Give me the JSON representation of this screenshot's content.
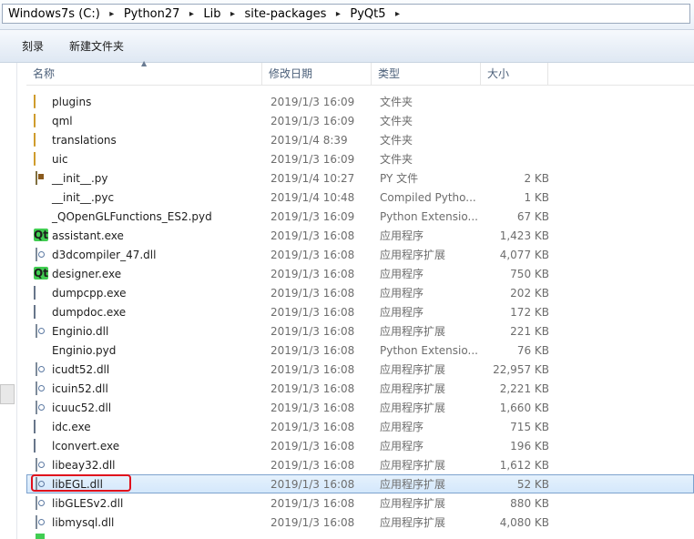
{
  "breadcrumb": [
    "Windows7s (C:)",
    "Python27",
    "Lib",
    "site-packages",
    "PyQt5"
  ],
  "toolbar": {
    "burn": "刻录",
    "new_folder": "新建文件夹"
  },
  "columns": {
    "name": "名称",
    "date": "修改日期",
    "type": "类型",
    "size": "大小"
  },
  "files": [
    {
      "name": "plugins",
      "date": "2019/1/3 16:09",
      "type": "文件夹",
      "size": "",
      "icon": "folder-icon"
    },
    {
      "name": "qml",
      "date": "2019/1/3 16:09",
      "type": "文件夹",
      "size": "",
      "icon": "folder-icon"
    },
    {
      "name": "translations",
      "date": "2019/1/4 8:39",
      "type": "文件夹",
      "size": "",
      "icon": "folder-icon"
    },
    {
      "name": "uic",
      "date": "2019/1/3 16:09",
      "type": "文件夹",
      "size": "",
      "icon": "folder-icon"
    },
    {
      "name": "__init__.py",
      "date": "2019/1/4 10:27",
      "type": "PY 文件",
      "size": "2 KB",
      "icon": "py-source-icon"
    },
    {
      "name": "__init__.pyc",
      "date": "2019/1/4 10:48",
      "type": "Compiled Pytho...",
      "size": "1 KB",
      "icon": "python-icon"
    },
    {
      "name": "_QOpenGLFunctions_ES2.pyd",
      "date": "2019/1/3 16:09",
      "type": "Python Extensio...",
      "size": "67 KB",
      "icon": "python-icon"
    },
    {
      "name": "assistant.exe",
      "date": "2019/1/3 16:08",
      "type": "应用程序",
      "size": "1,423 KB",
      "icon": "qt-icon"
    },
    {
      "name": "d3dcompiler_47.dll",
      "date": "2019/1/3 16:08",
      "type": "应用程序扩展",
      "size": "4,077 KB",
      "icon": "dll-icon"
    },
    {
      "name": "designer.exe",
      "date": "2019/1/3 16:08",
      "type": "应用程序",
      "size": "750 KB",
      "icon": "qt-icon"
    },
    {
      "name": "dumpcpp.exe",
      "date": "2019/1/3 16:08",
      "type": "应用程序",
      "size": "202 KB",
      "icon": "exe-icon"
    },
    {
      "name": "dumpdoc.exe",
      "date": "2019/1/3 16:08",
      "type": "应用程序",
      "size": "172 KB",
      "icon": "exe-icon"
    },
    {
      "name": "Enginio.dll",
      "date": "2019/1/3 16:08",
      "type": "应用程序扩展",
      "size": "221 KB",
      "icon": "dll-icon"
    },
    {
      "name": "Enginio.pyd",
      "date": "2019/1/3 16:08",
      "type": "Python Extensio...",
      "size": "76 KB",
      "icon": "python-icon"
    },
    {
      "name": "icudt52.dll",
      "date": "2019/1/3 16:08",
      "type": "应用程序扩展",
      "size": "22,957 KB",
      "icon": "dll-icon"
    },
    {
      "name": "icuin52.dll",
      "date": "2019/1/3 16:08",
      "type": "应用程序扩展",
      "size": "2,221 KB",
      "icon": "dll-icon"
    },
    {
      "name": "icuuc52.dll",
      "date": "2019/1/3 16:08",
      "type": "应用程序扩展",
      "size": "1,660 KB",
      "icon": "dll-icon"
    },
    {
      "name": "idc.exe",
      "date": "2019/1/3 16:08",
      "type": "应用程序",
      "size": "715 KB",
      "icon": "exe-icon"
    },
    {
      "name": "lconvert.exe",
      "date": "2019/1/3 16:08",
      "type": "应用程序",
      "size": "196 KB",
      "icon": "exe-icon"
    },
    {
      "name": "libeay32.dll",
      "date": "2019/1/3 16:08",
      "type": "应用程序扩展",
      "size": "1,612 KB",
      "icon": "dll-icon"
    },
    {
      "name": "libEGL.dll",
      "date": "2019/1/3 16:08",
      "type": "应用程序扩展",
      "size": "52 KB",
      "icon": "dll-icon",
      "selected": true
    },
    {
      "name": "libGLESv2.dll",
      "date": "2019/1/3 16:08",
      "type": "应用程序扩展",
      "size": "880 KB",
      "icon": "dll-icon"
    },
    {
      "name": "libmysql.dll",
      "date": "2019/1/3 16:08",
      "type": "应用程序扩展",
      "size": "4,080 KB",
      "icon": "dll-icon"
    }
  ],
  "highlight_color": "#e0101c",
  "selection_color": "#d3e7fb"
}
